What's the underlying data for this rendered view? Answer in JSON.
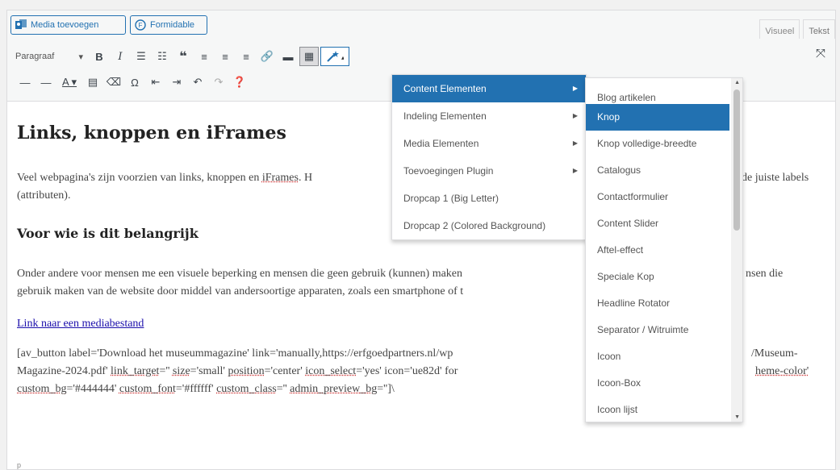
{
  "media_bar": {
    "add_media": "Media toevoegen",
    "formidable": "Formidable"
  },
  "modes": {
    "visual": "Visueel",
    "text": "Tekst"
  },
  "toolbar": {
    "format": "Paragraaf",
    "bold": "B",
    "italic": "I"
  },
  "content": {
    "heading": "Links, knoppen en iFrames",
    "p1_a": "Veel webpagina's zijn voorzien van links, knoppen en ",
    "p1_iframes": "iFrames",
    "p1_b": ". H",
    "p1_tail": "de juiste labels",
    "p1_line2": "(attributen).",
    "heading2": "Voor wie is dit belangrijk",
    "p2_line1": "Onder andere voor mensen me een visuele beperking en mensen die geen gebruik (kunnen) maken",
    "p2_tail": "nsen die",
    "p2_line2": "gebruik maken van de website door middel van andersoortige apparaten, zoals een smartphone of t",
    "link": "Link naar een mediabestand",
    "shortcode_l1": "[av_button label='Download het museummagazine' link='manually,https://erfgoedpartners.nl/wp",
    "shortcode_l1_tail": "/Museum-",
    "shortcode_l2a": "Magazine-2024.pdf' ",
    "shortcode_l2_link_target": "link_target",
    "shortcode_l2b": "='' ",
    "shortcode_l2_size": "size",
    "shortcode_l2c": "='small' ",
    "shortcode_l2_position": "position",
    "shortcode_l2d": "='center' ",
    "shortcode_l2_icon_select": "icon_select",
    "shortcode_l2e": "='yes' icon='ue82d' for",
    "shortcode_l2_tail": "heme-color'",
    "shortcode_l3_custom_bg": "custom_bg",
    "shortcode_l3a": "='#444444' ",
    "shortcode_l3_custom_font": "custom_font",
    "shortcode_l3b": "='#ffffff' ",
    "shortcode_l3_custom_class": "custom_class",
    "shortcode_l3c": "='' ",
    "shortcode_l3_admin": "admin_preview_bg",
    "shortcode_l3d": "='']\\",
    "path": "p"
  },
  "menu1": [
    {
      "label": "Content Elementen",
      "submenu": true,
      "active": true
    },
    {
      "label": "Indeling Elementen",
      "submenu": true
    },
    {
      "label": "Media Elementen",
      "submenu": true
    },
    {
      "label": "Toevoegingen Plugin",
      "submenu": true
    },
    {
      "label": "Dropcap 1 (Big Letter)",
      "submenu": false
    },
    {
      "label": "Dropcap 2 (Colored Background)",
      "submenu": false
    }
  ],
  "menu2": [
    "Blog artikelen",
    "Knop",
    "Knop volledige-breedte",
    "Catalogus",
    "Contactformulier",
    "Content Slider",
    "Aftel-effect",
    "Speciale Kop",
    "Headline Rotator",
    "Separator / Witruimte",
    "Icoon",
    "Icoon-Box",
    "Icoon lijst"
  ],
  "colors": {
    "accent": "#2271b1",
    "link": "#1a0dab"
  }
}
